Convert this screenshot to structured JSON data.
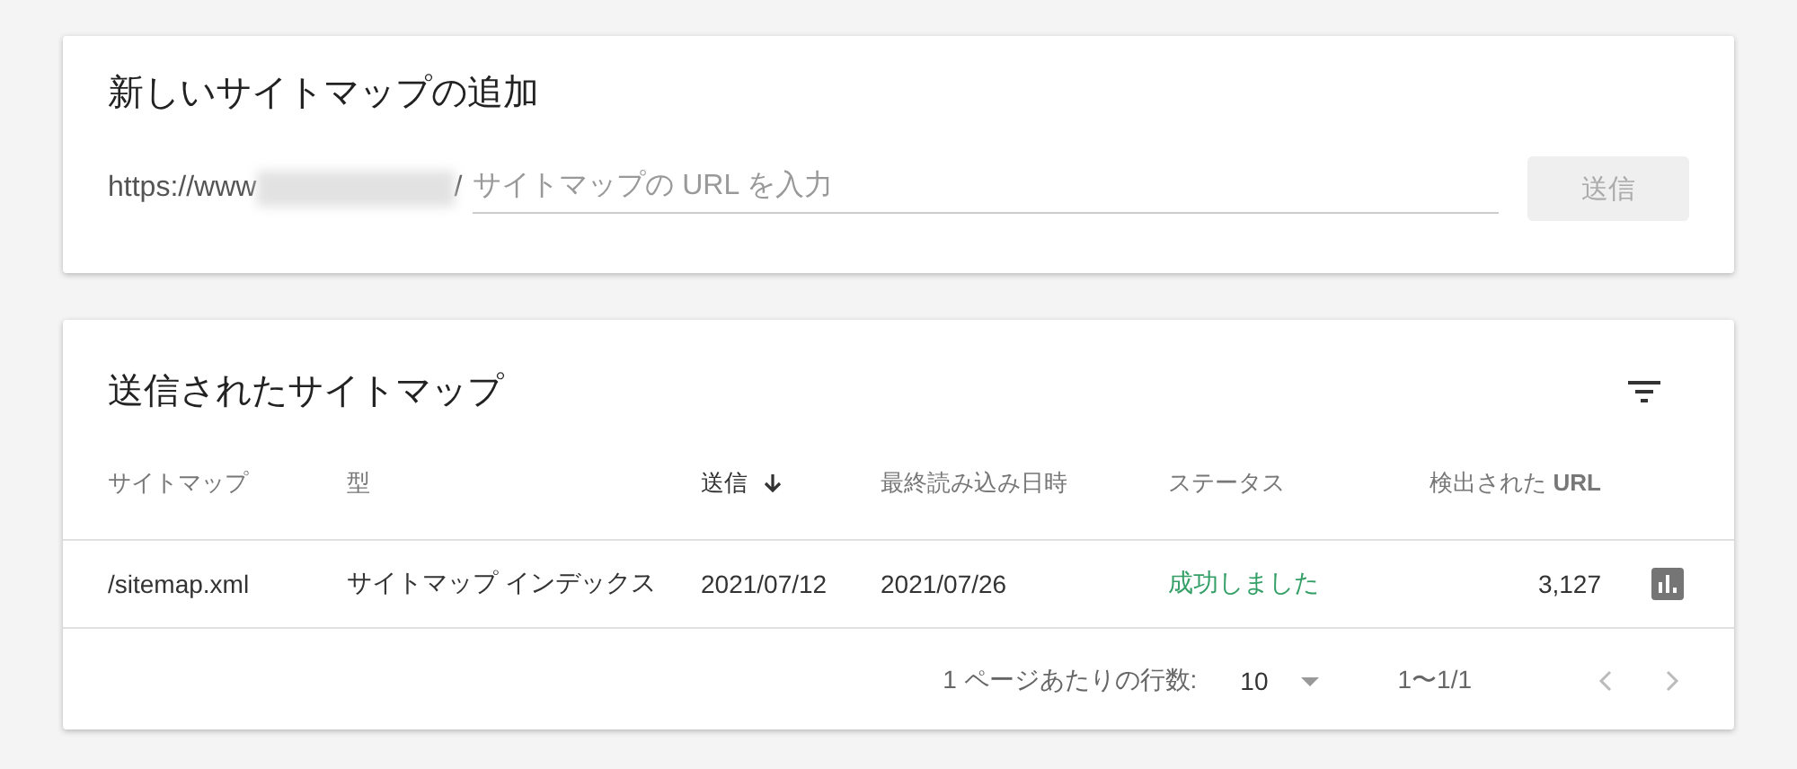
{
  "add_card": {
    "title": "新しいサイトマップの追加",
    "url_prefix": "https://www",
    "url_suffix": "/",
    "input": {
      "placeholder": "サイトマップの URL を入力"
    },
    "submit": {
      "label": "送信",
      "disabled": true
    }
  },
  "sitemaps_card": {
    "title": "送信されたサイトマップ",
    "table": {
      "columns": [
        {
          "label": "サイトマップ",
          "sorted": false
        },
        {
          "label": "型",
          "sorted": false
        },
        {
          "label": "送信",
          "sorted": true
        },
        {
          "label": "最終読み込み日時",
          "sorted": false
        },
        {
          "label": "ステータス",
          "sorted": false
        },
        {
          "label": "検出された **URL**",
          "sorted": false
        }
      ],
      "rows": [
        {
          "cells": [
            "/sitemap.xml",
            "サイトマップ インデックス",
            "2021/07/12",
            "2021/07/26",
            "成功しました",
            "3,127"
          ]
        }
      ]
    },
    "pagination": {
      "rows_label": "1 ページあたりの行数:",
      "rows_value": "10",
      "range": "1〜1/1",
      "prev_disabled": true,
      "next_disabled": true
    }
  }
}
